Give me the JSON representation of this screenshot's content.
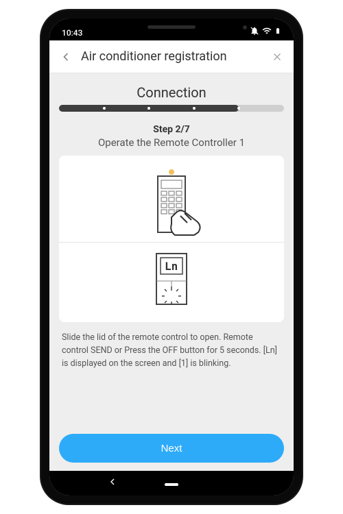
{
  "status_bar": {
    "time": "10:43"
  },
  "header": {
    "title": "Air conditioner registration"
  },
  "section": {
    "title": "Connection"
  },
  "step": {
    "label": "Step 2/7",
    "title": "Operate the Remote Controller 1",
    "instruction": "Slide the lid of the remote control to open. Remote control SEND or Press the OFF button for 5 seconds. [Ln] is displayed on the screen and [1] is blinking."
  },
  "buttons": {
    "next": "Next"
  },
  "icons": {
    "back": "back-chevron",
    "close": "close-x",
    "bell_muted": "notifications-off",
    "wifi": "wifi",
    "battery": "battery"
  }
}
